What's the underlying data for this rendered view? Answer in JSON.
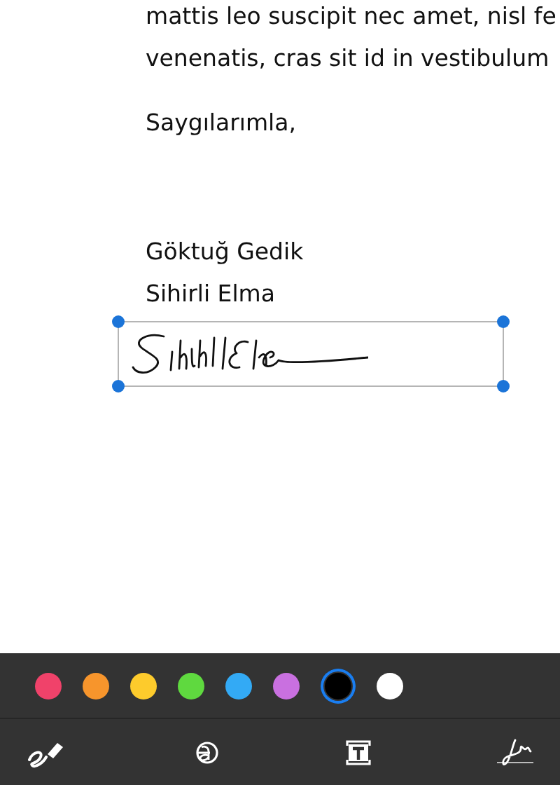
{
  "document": {
    "lines": [
      "mattis leo suscipit nec amet, nisl fe",
      "venenatis, cras sit id in vestibulum"
    ],
    "closing": "Saygılarımla,",
    "signature_lines": [
      "Göktuğ Gedik",
      "Sihirli Elma"
    ],
    "signature_annotation": {
      "selected": true
    }
  },
  "color_palette": [
    {
      "color": "#f0426a",
      "selected": false
    },
    {
      "color": "#f7952c",
      "selected": false
    },
    {
      "color": "#fdcb2c",
      "selected": false
    },
    {
      "color": "#5fd93f",
      "selected": false
    },
    {
      "color": "#33aaf5",
      "selected": false
    },
    {
      "color": "#c970e0",
      "selected": false
    },
    {
      "color": "#000000",
      "selected": true
    },
    {
      "color": "#ffffff",
      "selected": false
    }
  ]
}
